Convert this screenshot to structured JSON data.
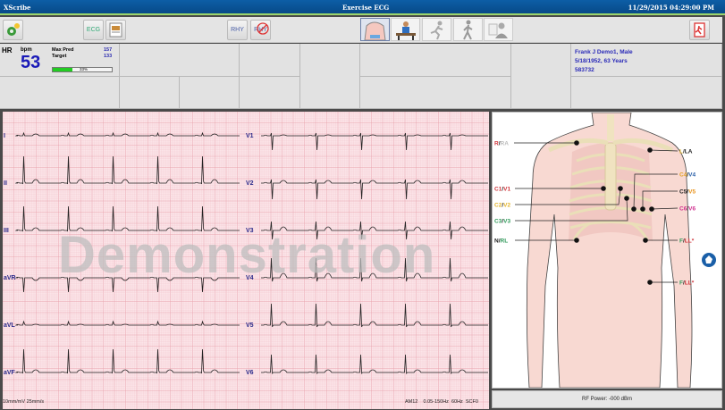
{
  "window": {
    "app_name": "XScribe",
    "title": "Exercise ECG",
    "datetime": "11/29/2015 04:29:00 PM"
  },
  "toolbar": {
    "buttons": [
      {
        "name": "settings",
        "icon": "gear-icon"
      },
      {
        "name": "ecg",
        "label": "ECG"
      },
      {
        "name": "report",
        "icon": "report-icon"
      },
      {
        "name": "rhythm",
        "label": "RHY"
      },
      {
        "name": "rhythm-stop",
        "label": "RHY"
      }
    ],
    "modes": [
      {
        "name": "electrode-placement",
        "icon": "torso-icon",
        "selected": true
      },
      {
        "name": "pretest-seated",
        "icon": "seated-icon",
        "selected": false
      },
      {
        "name": "exercise",
        "icon": "running-icon",
        "selected": false
      },
      {
        "name": "recovery",
        "icon": "walking-icon",
        "selected": false
      },
      {
        "name": "review",
        "icon": "doctor-icon",
        "selected": false
      }
    ],
    "exit_icon": "exit-icon"
  },
  "hr": {
    "label": "HR",
    "unit": "bpm",
    "value": "53",
    "max_pred_label": "Max Pred",
    "max_pred": "157",
    "target_label": "Target",
    "target": "133",
    "progress_percent": 33,
    "progress_label": "33%"
  },
  "patient": {
    "name_line": "Frank J Demo1, Male",
    "dob_line": "5/18/1952, 63 Years",
    "id": "583732"
  },
  "ecg": {
    "leads_left": [
      "I",
      "II",
      "III",
      "aVR",
      "aVL",
      "aVF"
    ],
    "leads_right": [
      "V1",
      "V2",
      "V3",
      "V4",
      "V5",
      "V6"
    ],
    "watermark": "Demonstration",
    "gain_speed": "10mm/mV  25mm/s",
    "filter_info": "AM12    0.05-150Hz  60Hz  SCF0",
    "colors": {
      "grid_bg": "#fbe4e8",
      "grid_minor": "#f3c4cc",
      "grid_major": "#e9a3ae",
      "trace": "#222222"
    }
  },
  "electrodes": [
    {
      "a": "R",
      "ac": "#d0343a",
      "b": "RA",
      "bc": "#bbbbbb",
      "side": "left"
    },
    {
      "a": "L",
      "ac": "#e3b429",
      "b": "LA",
      "bc": "#222222",
      "side": "right"
    },
    {
      "a": "C4",
      "ac": "#e3a229",
      "b": "V4",
      "bc": "#2a5fa8",
      "side": "right"
    },
    {
      "a": "C5",
      "ac": "#222222",
      "b": "V5",
      "bc": "#e8921a",
      "side": "right"
    },
    {
      "a": "C6",
      "ac": "#d0308f",
      "b": "V6",
      "bc": "#d0308f",
      "side": "right"
    },
    {
      "a": "C1",
      "ac": "#d0343a",
      "b": "V1",
      "bc": "#d0343a",
      "side": "left"
    },
    {
      "a": "C2",
      "ac": "#e3b429",
      "b": "V2",
      "bc": "#e3b429",
      "side": "left"
    },
    {
      "a": "C3",
      "ac": "#2f9a5a",
      "b": "V3",
      "bc": "#2f9a5a",
      "side": "left"
    },
    {
      "a": "N",
      "ac": "#222222",
      "b": "RL",
      "bc": "#2f9a5a",
      "side": "left"
    },
    {
      "a": "F",
      "ac": "#2f9a5a",
      "b": "LL*",
      "bc": "#d0343a",
      "side": "right"
    },
    {
      "a": "F",
      "ac": "#2f9a5a",
      "b": "LL*",
      "bc": "#d0343a",
      "side": "right"
    }
  ],
  "rf": {
    "label": "RF Power: -000 dBm"
  }
}
